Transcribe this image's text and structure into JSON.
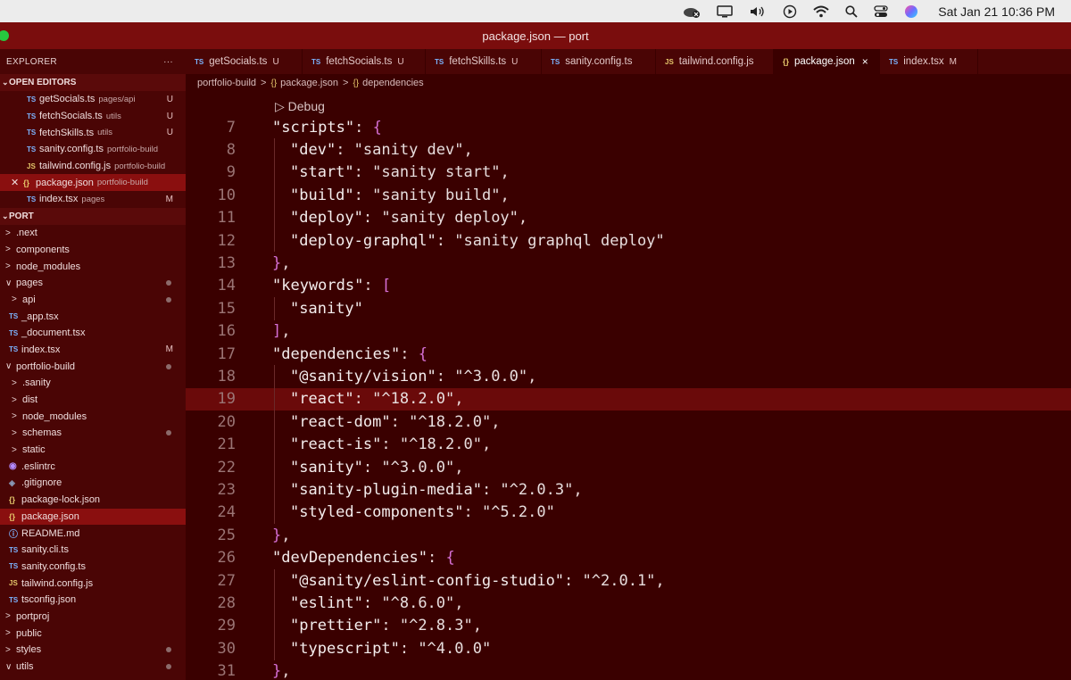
{
  "menubar": {
    "clock": "Sat Jan 21  10:36 PM"
  },
  "window": {
    "title": "package.json — port"
  },
  "sidebar": {
    "header": "EXPLORER",
    "header_more": "···",
    "open_editors_label": "OPEN EDITORS",
    "open_editors": [
      {
        "badge": "TS",
        "name": "getSocials.ts",
        "path": "pages/api",
        "status": "U"
      },
      {
        "badge": "TS",
        "name": "fetchSocials.ts",
        "path": "utils",
        "status": "U"
      },
      {
        "badge": "TS",
        "name": "fetchSkills.ts",
        "path": "utils",
        "status": "U"
      },
      {
        "badge": "TS",
        "name": "sanity.config.ts",
        "path": "portfolio-build",
        "status": ""
      },
      {
        "badge": "JS",
        "name": "tailwind.config.js",
        "path": "portfolio-build",
        "status": ""
      },
      {
        "badge": "{}",
        "name": "package.json",
        "path": "portfolio-build",
        "status": ""
      },
      {
        "badge": "TS",
        "name": "index.tsx",
        "path": "pages",
        "status": "M"
      }
    ],
    "workspace_label": "PORT",
    "tree": [
      {
        "name": ".next",
        "chev": ">"
      },
      {
        "name": "components",
        "chev": ">"
      },
      {
        "name": "node_modules",
        "chev": ">"
      },
      {
        "name": "pages",
        "chev": "∨"
      },
      {
        "name": "api",
        "chev": ">"
      },
      {
        "badge": "TS",
        "name": "_app.tsx"
      },
      {
        "badge": "TS",
        "name": "_document.tsx"
      },
      {
        "badge": "TS",
        "name": "index.tsx",
        "status": "M"
      },
      {
        "name": "portfolio-build",
        "chev": "∨"
      },
      {
        "name": ".sanity",
        "chev": ">"
      },
      {
        "name": "dist",
        "chev": ">"
      },
      {
        "name": "node_modules",
        "chev": ">"
      },
      {
        "name": "schemas",
        "chev": ">"
      },
      {
        "name": "static",
        "chev": ">"
      },
      {
        "badge": "◉",
        "name": ".eslintrc"
      },
      {
        "badge": "◈",
        "name": ".gitignore"
      },
      {
        "badge": "{}",
        "name": "package-lock.json"
      },
      {
        "badge": "{}",
        "name": "package.json"
      },
      {
        "badge": "ⓘ",
        "name": "README.md"
      },
      {
        "badge": "TS",
        "name": "sanity.cli.ts"
      },
      {
        "badge": "TS",
        "name": "sanity.config.ts"
      },
      {
        "badge": "JS",
        "name": "tailwind.config.js"
      },
      {
        "badge": "TS",
        "name": "tsconfig.json"
      },
      {
        "name": "portproj",
        "chev": ">"
      },
      {
        "name": "public",
        "chev": ">"
      },
      {
        "name": "styles",
        "chev": ">"
      },
      {
        "name": "utils",
        "chev": "∨"
      }
    ]
  },
  "tabs": [
    {
      "icon": "TS",
      "label": "getSocials.ts",
      "status": "U"
    },
    {
      "icon": "TS",
      "label": "fetchSocials.ts",
      "status": "U"
    },
    {
      "icon": "TS",
      "label": "fetchSkills.ts",
      "status": "U"
    },
    {
      "icon": "TS",
      "label": "sanity.config.ts",
      "status": ""
    },
    {
      "icon": "JS",
      "label": "tailwind.config.js",
      "status": ""
    },
    {
      "icon": "{}",
      "label": "package.json",
      "status": "×"
    },
    {
      "icon": "TS",
      "label": "index.tsx",
      "status": "M"
    }
  ],
  "breadcrumb": {
    "folder": "portfolio-build",
    "file": "package.json",
    "key": "dependencies",
    "sep": ">",
    "icon": "{}"
  },
  "editor": {
    "codelens": "▷ Debug",
    "lines": [
      {
        "n": "7",
        "text": "\"scripts\": {"
      },
      {
        "n": "8",
        "text": "\"dev\": \"sanity dev\","
      },
      {
        "n": "9",
        "text": "\"start\": \"sanity start\","
      },
      {
        "n": "10",
        "text": "\"build\": \"sanity build\","
      },
      {
        "n": "11",
        "text": "\"deploy\": \"sanity deploy\","
      },
      {
        "n": "12",
        "text": "\"deploy-graphql\": \"sanity graphql deploy\""
      },
      {
        "n": "13",
        "text": "},"
      },
      {
        "n": "14",
        "text": "\"keywords\": ["
      },
      {
        "n": "15",
        "text": "\"sanity\""
      },
      {
        "n": "16",
        "text": "],"
      },
      {
        "n": "17",
        "text": "\"dependencies\": {"
      },
      {
        "n": "18",
        "text": "\"@sanity/vision\": \"^3.0.0\","
      },
      {
        "n": "19",
        "text": "\"react\": \"^18.2.0\","
      },
      {
        "n": "20",
        "text": "\"react-dom\": \"^18.2.0\","
      },
      {
        "n": "21",
        "text": "\"react-is\": \"^18.2.0\","
      },
      {
        "n": "22",
        "text": "\"sanity\": \"^3.0.0\","
      },
      {
        "n": "23",
        "text": "\"sanity-plugin-media\": \"^2.0.3\","
      },
      {
        "n": "24",
        "text": "\"styled-components\": \"^5.2.0\""
      },
      {
        "n": "25",
        "text": "},"
      },
      {
        "n": "26",
        "text": "\"devDependencies\": {"
      },
      {
        "n": "27",
        "text": "\"@sanity/eslint-config-studio\": \"^2.0.1\","
      },
      {
        "n": "28",
        "text": "\"eslint\": \"^8.6.0\","
      },
      {
        "n": "29",
        "text": "\"prettier\": \"^2.8.3\","
      },
      {
        "n": "30",
        "text": "\"typescript\": \"^4.0.0\""
      },
      {
        "n": "31",
        "text": "},"
      }
    ]
  }
}
